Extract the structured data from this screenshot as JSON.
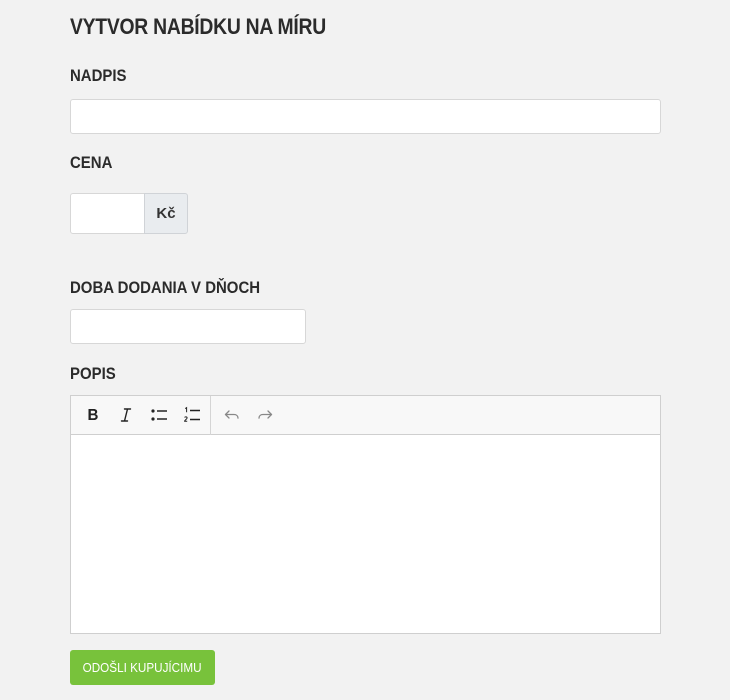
{
  "form": {
    "title": "VYTVOR NABÍDKU NA MÍRU",
    "heading_label": "NADPIS",
    "heading_value": "",
    "price_label": "CENA",
    "price_value": "",
    "currency": "Kč",
    "delivery_label": "DOBA DODANIA V DŇOCH",
    "delivery_value": "",
    "description_label": "POPIS",
    "description_value": "",
    "submit_label": "ODOŠLI KUPUJÍCIMU"
  },
  "toolbar": {
    "buttons": [
      {
        "icon": "bold-icon"
      },
      {
        "icon": "italic-icon"
      },
      {
        "icon": "bulleted-list-icon"
      },
      {
        "icon": "numbered-list-icon"
      },
      {
        "icon": "undo-icon"
      },
      {
        "icon": "redo-icon"
      }
    ]
  },
  "colors": {
    "background": "#f2f2f2",
    "submit": "#78c23b",
    "addon": "#e9ecef"
  }
}
